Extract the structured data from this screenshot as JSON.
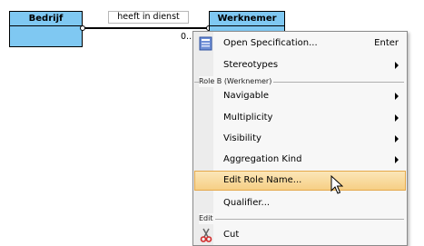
{
  "diagram": {
    "class_left": {
      "name": "Bedrijf"
    },
    "class_right": {
      "name": "Werknemer"
    },
    "association": {
      "name": "heeft in dienst",
      "multiplicity": "0.."
    }
  },
  "context_menu": {
    "items_top": [
      {
        "label": "Open Specification...",
        "shortcut": "Enter",
        "icon": "specification-icon"
      },
      {
        "label": "Stereotypes",
        "submenu": true
      }
    ],
    "section_role": {
      "title": "Role B (Werknemer)",
      "items": [
        {
          "label": "Navigable",
          "submenu": true
        },
        {
          "label": "Multiplicity",
          "submenu": true
        },
        {
          "label": "Visibility",
          "submenu": true
        },
        {
          "label": "Aggregation Kind",
          "submenu": true
        },
        {
          "label": "Edit Role Name...",
          "highlighted": true
        },
        {
          "label": "Qualifier..."
        }
      ]
    },
    "section_edit": {
      "title": "Edit",
      "items": [
        {
          "label": "Cut",
          "icon": "scissors-icon"
        }
      ]
    }
  },
  "colors": {
    "class_fill": "#7fc8f2",
    "highlight": "#f6cf85"
  }
}
